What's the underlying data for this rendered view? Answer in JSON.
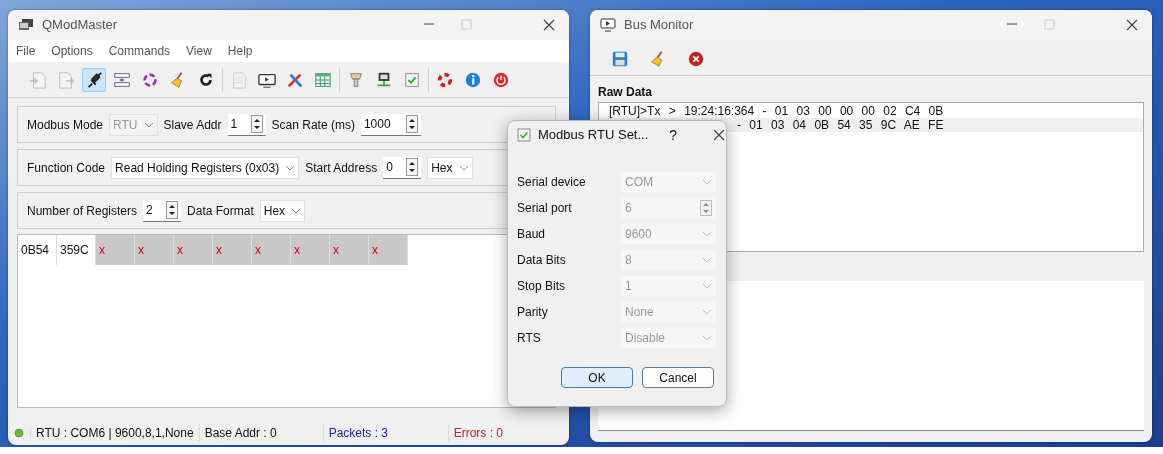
{
  "main_window": {
    "title": "QModMaster",
    "menu": [
      "File",
      "Options",
      "Commands",
      "View",
      "Help"
    ],
    "toolbar": [
      [
        {
          "kind": "load",
          "disabled": true,
          "checked": false
        },
        {
          "kind": "save",
          "disabled": true,
          "checked": false
        },
        {
          "kind": "connect",
          "disabled": false,
          "checked": true
        },
        {
          "kind": "scan",
          "disabled": false,
          "checked": false
        },
        {
          "kind": "cycle",
          "disabled": false,
          "checked": false
        },
        {
          "kind": "clear",
          "disabled": false,
          "checked": false
        },
        {
          "kind": "refresh",
          "disabled": false,
          "checked": false
        }
      ],
      [
        {
          "kind": "log",
          "disabled": true,
          "checked": false
        },
        {
          "kind": "monitor",
          "disabled": false,
          "checked": false
        },
        {
          "kind": "tools",
          "disabled": false,
          "checked": false
        },
        {
          "kind": "table",
          "disabled": false,
          "checked": false
        }
      ],
      [
        {
          "kind": "serial",
          "disabled": false,
          "checked": false
        },
        {
          "kind": "tcp",
          "disabled": false,
          "checked": false
        },
        {
          "kind": "headers",
          "disabled": false,
          "checked": false
        }
      ],
      [
        {
          "kind": "help",
          "disabled": false,
          "checked": false
        },
        {
          "kind": "about",
          "disabled": false,
          "checked": false
        },
        {
          "kind": "exit",
          "disabled": false,
          "checked": false
        }
      ]
    ],
    "settings_rows": [
      [
        {
          "kind": "label",
          "text": "Modbus Mode"
        },
        {
          "kind": "combo",
          "value": "RTU",
          "disabled": true
        },
        {
          "kind": "label",
          "text": "Slave Addr"
        },
        {
          "kind": "spin",
          "value": "1",
          "disabled": false
        },
        {
          "kind": "label",
          "text": "Scan Rate (ms)"
        },
        {
          "kind": "spin",
          "value": "1000",
          "disabled": false
        }
      ],
      [
        {
          "kind": "label",
          "text": "Function Code"
        },
        {
          "kind": "combo",
          "value": "Read Holding Registers (0x03)",
          "disabled": false
        },
        {
          "kind": "label",
          "text": "Start Address"
        },
        {
          "kind": "spin",
          "value": "0",
          "disabled": false
        },
        {
          "kind": "combo",
          "value": "Hex",
          "disabled": false
        }
      ],
      [
        {
          "kind": "label",
          "text": "Number of Registers"
        },
        {
          "kind": "spin",
          "value": "2",
          "disabled": false
        },
        {
          "kind": "label",
          "text": "Data Format"
        },
        {
          "kind": "combo",
          "value": "Hex",
          "disabled": false
        }
      ]
    ],
    "registers": [
      {
        "value": "0B54",
        "valid": true
      },
      {
        "value": "359C",
        "valid": true
      },
      {
        "value": "x",
        "valid": false
      },
      {
        "value": "x",
        "valid": false
      },
      {
        "value": "x",
        "valid": false
      },
      {
        "value": "x",
        "valid": false
      },
      {
        "value": "x",
        "valid": false
      },
      {
        "value": "x",
        "valid": false
      },
      {
        "value": "x",
        "valid": false
      },
      {
        "value": "x",
        "valid": false
      }
    ],
    "status_bar": {
      "connected": true,
      "port": "RTU : COM6 | 9600,8,1,None",
      "base_addr": "Base Addr : 0",
      "packets": "Packets : 3",
      "errors": "Errors : 0"
    }
  },
  "bus_monitor": {
    "title": "Bus Monitor",
    "toolbar": [
      {
        "kind": "save"
      },
      {
        "kind": "clear"
      },
      {
        "kind": "stop"
      }
    ],
    "section": "Raw Data",
    "lines": [
      {
        "text": "[RTU]>Tx > 19:24:16:364 - 01 03 00 00 00 02 C4 0B",
        "selected": false
      },
      {
        "text": "- 01 03 04 0B 54 35 9C AE FE",
        "selected": true
      }
    ]
  },
  "dialog": {
    "title": "Modbus RTU Set...",
    "help": "?",
    "fields": [
      {
        "label": "Serial device",
        "kind": "combo",
        "value": "COM",
        "disabled": true
      },
      {
        "label": "Serial port",
        "kind": "spin",
        "value": "6",
        "disabled": true
      },
      {
        "label": "Baud",
        "kind": "combo",
        "value": "9600",
        "disabled": true
      },
      {
        "label": "Data Bits",
        "kind": "combo",
        "value": "8",
        "disabled": true
      },
      {
        "label": "Stop Bits",
        "kind": "combo",
        "value": "1",
        "disabled": true
      },
      {
        "label": "Parity",
        "kind": "combo",
        "value": "None",
        "disabled": true
      },
      {
        "label": "RTS",
        "kind": "combo",
        "value": "Disable",
        "disabled": true
      }
    ],
    "buttons": [
      {
        "label": "OK",
        "default": true
      },
      {
        "label": "Cancel",
        "default": false
      }
    ]
  }
}
